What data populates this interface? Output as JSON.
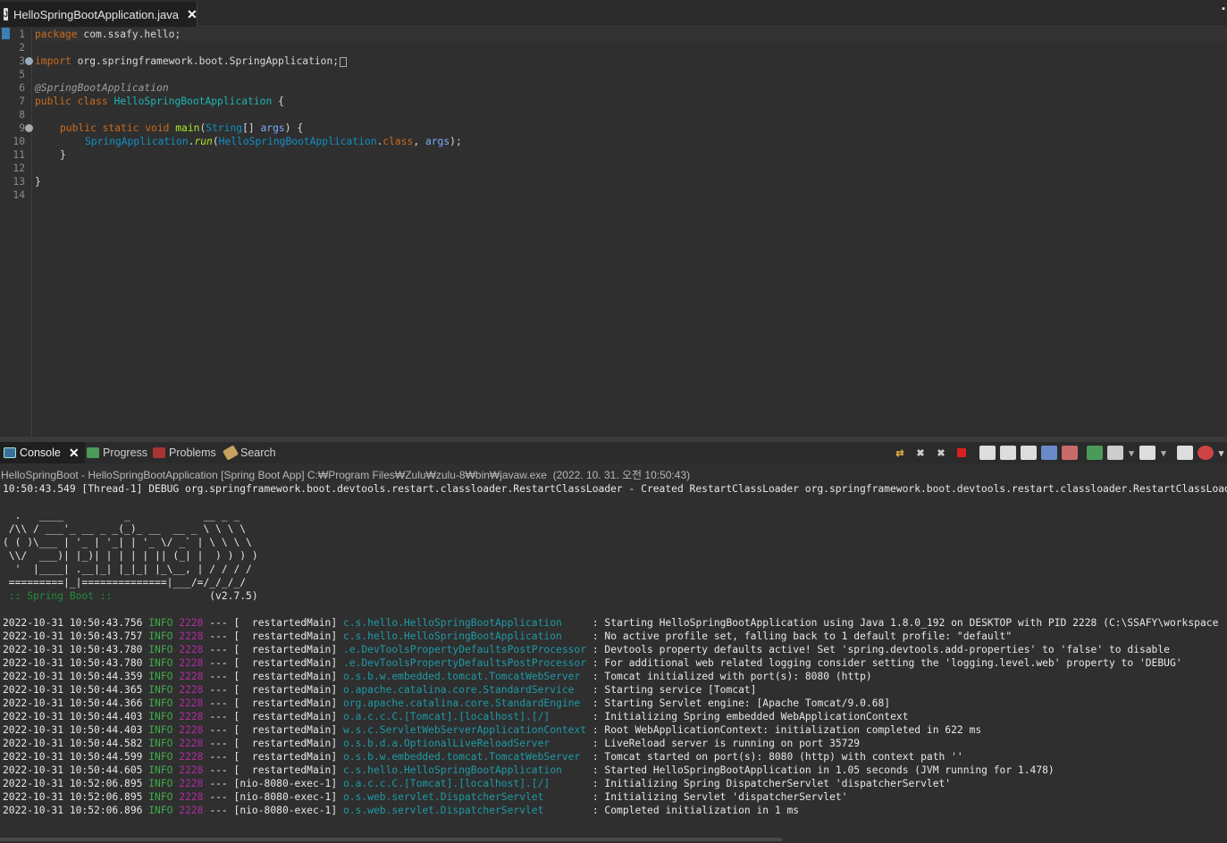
{
  "editor": {
    "tab_title": "HelloSpringBootApplication.java",
    "tab_icon": "java-file-icon",
    "line_numbers": [
      "1",
      "2",
      "3",
      "5",
      "6",
      "7",
      "8",
      "9",
      "10",
      "11",
      "12",
      "13",
      "14"
    ],
    "code": {
      "l1_kw": "package",
      "l1_rest": " com.ssafy.hello;",
      "l3_kw": "import",
      "l3_rest": " org.springframework.boot.SpringApplication;",
      "l6": "@SpringBootApplication",
      "l7_kw": "public class",
      "l7_cls": "HelloSpringBootApplication",
      "l7_rest": " {",
      "l9_kw": "public static void",
      "l9_m": "main",
      "l9_open": "(",
      "l9_type": "String",
      "l9_mid": "[] ",
      "l9_param": "args",
      "l9_end": ") {",
      "l10_cls": "SpringApplication",
      "l10_dot": ".",
      "l10_m": "run",
      "l10_open": "(",
      "l10_arg1": "HelloSpringBootApplication",
      "l10_dot2": ".",
      "l10_class": "class",
      "l10_comma": ", ",
      "l10_arg2": "args",
      "l10_end": ");",
      "l11": "}",
      "l13": "}"
    }
  },
  "console": {
    "tabs": [
      {
        "label": "Console",
        "icon": "console-icon",
        "active": true
      },
      {
        "label": "Progress",
        "icon": "progress-icon"
      },
      {
        "label": "Problems",
        "icon": "problems-icon"
      },
      {
        "label": "Search",
        "icon": "search-icon"
      }
    ],
    "launch_info": "HelloSpringBoot - HelloSpringBootApplication [Spring Boot App] C:₩Program Files₩Zulu₩zulu-8₩bin₩javaw.exe  (2022. 10. 31. 오전 10:50:43)",
    "debug_line": "10:50:43.549 [Thread-1] DEBUG org.springframework.boot.devtools.restart.classloader.RestartClassLoader - Created RestartClassLoader org.springframework.boot.devtools.restart.classloader.RestartClassLoader",
    "banner": [
      "  .   ____          _            __ _ _",
      " /\\\\ / ___'_ __ _ _(_)_ __  __ _ \\ \\ \\ \\",
      "( ( )\\___ | '_ | '_| | '_ \\/ _` | \\ \\ \\ \\",
      " \\\\/  ___)| |_)| | | | | || (_| |  ) ) ) )",
      "  '  |____| .__|_| |_|_| |_\\__, | / / / /",
      " =========|_|==============|___/=/_/_/_/"
    ],
    "banner_label": " :: Spring Boot :: ",
    "banner_version": "               (v2.7.5)",
    "log_level": "INFO",
    "log_pid": "2228",
    "log_sep": "---",
    "logs": [
      {
        "ts": "2022-10-31 10:50:43.756",
        "thread": "[  restartedMain]",
        "logger": "c.s.hello.HelloSpringBootApplication    ",
        "msg": " : Starting HelloSpringBootApplication using Java 1.8.0_192 on DESKTOP with PID 2228 (C:\\SSAFY\\workspace"
      },
      {
        "ts": "2022-10-31 10:50:43.757",
        "thread": "[  restartedMain]",
        "logger": "c.s.hello.HelloSpringBootApplication    ",
        "msg": " : No active profile set, falling back to 1 default profile: \"default\""
      },
      {
        "ts": "2022-10-31 10:50:43.780",
        "thread": "[  restartedMain]",
        "logger": ".e.DevToolsPropertyDefaultsPostProcessor",
        "msg": " : Devtools property defaults active! Set 'spring.devtools.add-properties' to 'false' to disable"
      },
      {
        "ts": "2022-10-31 10:50:43.780",
        "thread": "[  restartedMain]",
        "logger": ".e.DevToolsPropertyDefaultsPostProcessor",
        "msg": " : For additional web related logging consider setting the 'logging.level.web' property to 'DEBUG'"
      },
      {
        "ts": "2022-10-31 10:50:44.359",
        "thread": "[  restartedMain]",
        "logger": "o.s.b.w.embedded.tomcat.TomcatWebServer ",
        "msg": " : Tomcat initialized with port(s): 8080 (http)"
      },
      {
        "ts": "2022-10-31 10:50:44.365",
        "thread": "[  restartedMain]",
        "logger": "o.apache.catalina.core.StandardService  ",
        "msg": " : Starting service [Tomcat]"
      },
      {
        "ts": "2022-10-31 10:50:44.366",
        "thread": "[  restartedMain]",
        "logger": "org.apache.catalina.core.StandardEngine ",
        "msg": " : Starting Servlet engine: [Apache Tomcat/9.0.68]"
      },
      {
        "ts": "2022-10-31 10:50:44.403",
        "thread": "[  restartedMain]",
        "logger": "o.a.c.c.C.[Tomcat].[localhost].[/]      ",
        "msg": " : Initializing Spring embedded WebApplicationContext"
      },
      {
        "ts": "2022-10-31 10:50:44.403",
        "thread": "[  restartedMain]",
        "logger": "w.s.c.ServletWebServerApplicationContext",
        "msg": " : Root WebApplicationContext: initialization completed in 622 ms"
      },
      {
        "ts": "2022-10-31 10:50:44.582",
        "thread": "[  restartedMain]",
        "logger": "o.s.b.d.a.OptionalLiveReloadServer      ",
        "msg": " : LiveReload server is running on port 35729"
      },
      {
        "ts": "2022-10-31 10:50:44.599",
        "thread": "[  restartedMain]",
        "logger": "o.s.b.w.embedded.tomcat.TomcatWebServer ",
        "msg": " : Tomcat started on port(s): 8080 (http) with context path ''"
      },
      {
        "ts": "2022-10-31 10:50:44.605",
        "thread": "[  restartedMain]",
        "logger": "c.s.hello.HelloSpringBootApplication    ",
        "msg": " : Started HelloSpringBootApplication in 1.05 seconds (JVM running for 1.478)"
      },
      {
        "ts": "2022-10-31 10:52:06.895",
        "thread": "[nio-8080-exec-1]",
        "logger": "o.a.c.c.C.[Tomcat].[localhost].[/]      ",
        "msg": " : Initializing Spring DispatcherServlet 'dispatcherServlet'"
      },
      {
        "ts": "2022-10-31 10:52:06.895",
        "thread": "[nio-8080-exec-1]",
        "logger": "o.s.web.servlet.DispatcherServlet       ",
        "msg": " : Initializing Servlet 'dispatcherServlet'"
      },
      {
        "ts": "2022-10-31 10:52:06.896",
        "thread": "[nio-8080-exec-1]",
        "logger": "o.s.web.servlet.DispatcherServlet       ",
        "msg": " : Completed initialization in 1 ms"
      }
    ]
  },
  "colors": {
    "keyword": "#cc6c1d",
    "class_ref": "#1290c3",
    "method": "#a7ec21",
    "log_level": "#3faa4a",
    "pid": "#b02ca0",
    "logger": "#1e9aa6"
  }
}
